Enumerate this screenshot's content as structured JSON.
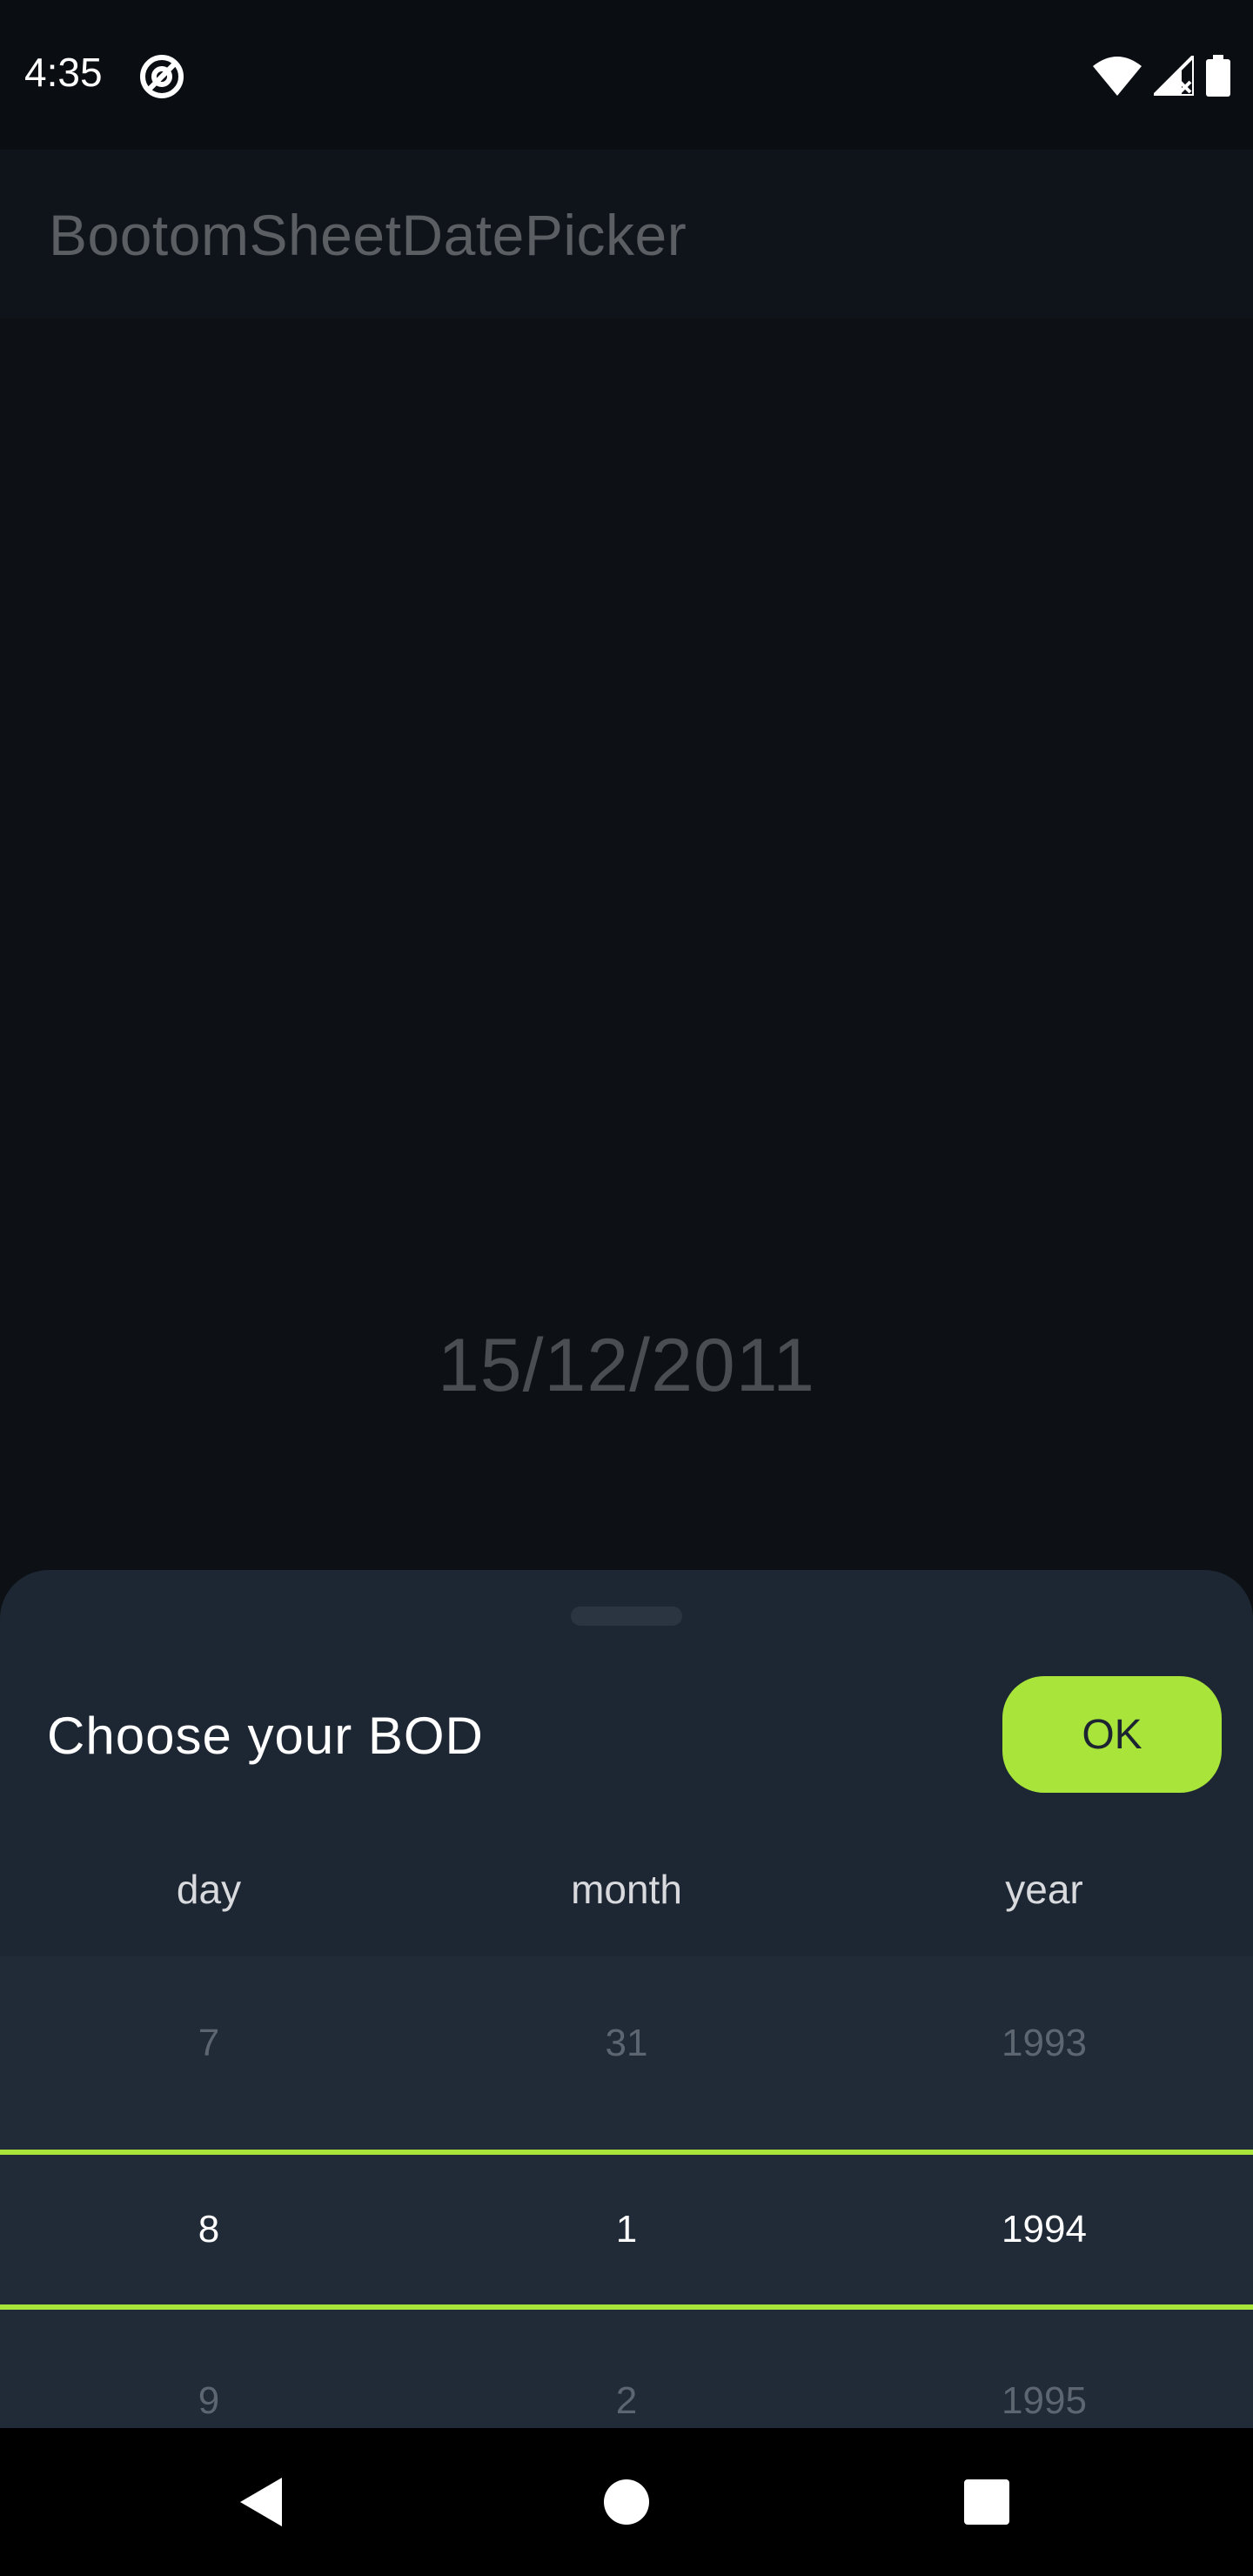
{
  "status_bar": {
    "time": "4:35",
    "icons": [
      "at-sign-icon",
      "wifi-icon",
      "signal-icon",
      "battery-icon"
    ]
  },
  "app_bar": {
    "title": "BootomSheetDatePicker"
  },
  "main": {
    "selected_date": "15/12/2011"
  },
  "bottom_sheet": {
    "title": "Choose your BOD",
    "ok_label": "OK",
    "columns": [
      "day",
      "month",
      "year"
    ],
    "rows": [
      {
        "day": "7",
        "month": "31",
        "year": "1993"
      },
      {
        "day": "8",
        "month": "1",
        "year": "1994"
      },
      {
        "day": "9",
        "month": "2",
        "year": "1995"
      }
    ],
    "accent_color": "#a9e43b",
    "sheet_color": "#1d2633"
  },
  "nav_bar": {
    "icons": [
      "back-icon",
      "home-icon",
      "recents-icon"
    ]
  }
}
